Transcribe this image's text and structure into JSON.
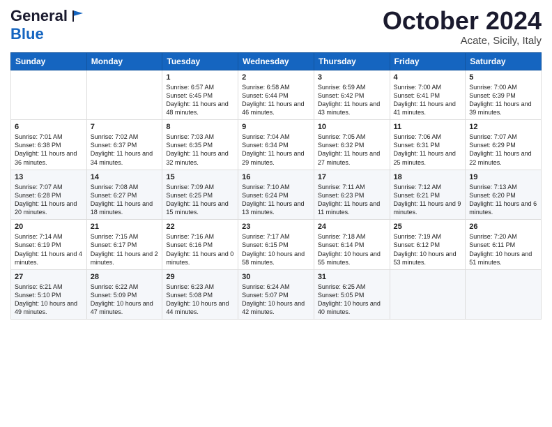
{
  "logo": {
    "general": "General",
    "blue": "Blue",
    "tagline": ""
  },
  "header": {
    "month": "October 2024",
    "location": "Acate, Sicily, Italy"
  },
  "weekdays": [
    "Sunday",
    "Monday",
    "Tuesday",
    "Wednesday",
    "Thursday",
    "Friday",
    "Saturday"
  ],
  "weeks": [
    [
      {
        "day": "",
        "info": ""
      },
      {
        "day": "",
        "info": ""
      },
      {
        "day": "1",
        "info": "Sunrise: 6:57 AM\nSunset: 6:45 PM\nDaylight: 11 hours and 48 minutes."
      },
      {
        "day": "2",
        "info": "Sunrise: 6:58 AM\nSunset: 6:44 PM\nDaylight: 11 hours and 46 minutes."
      },
      {
        "day": "3",
        "info": "Sunrise: 6:59 AM\nSunset: 6:42 PM\nDaylight: 11 hours and 43 minutes."
      },
      {
        "day": "4",
        "info": "Sunrise: 7:00 AM\nSunset: 6:41 PM\nDaylight: 11 hours and 41 minutes."
      },
      {
        "day": "5",
        "info": "Sunrise: 7:00 AM\nSunset: 6:39 PM\nDaylight: 11 hours and 39 minutes."
      }
    ],
    [
      {
        "day": "6",
        "info": "Sunrise: 7:01 AM\nSunset: 6:38 PM\nDaylight: 11 hours and 36 minutes."
      },
      {
        "day": "7",
        "info": "Sunrise: 7:02 AM\nSunset: 6:37 PM\nDaylight: 11 hours and 34 minutes."
      },
      {
        "day": "8",
        "info": "Sunrise: 7:03 AM\nSunset: 6:35 PM\nDaylight: 11 hours and 32 minutes."
      },
      {
        "day": "9",
        "info": "Sunrise: 7:04 AM\nSunset: 6:34 PM\nDaylight: 11 hours and 29 minutes."
      },
      {
        "day": "10",
        "info": "Sunrise: 7:05 AM\nSunset: 6:32 PM\nDaylight: 11 hours and 27 minutes."
      },
      {
        "day": "11",
        "info": "Sunrise: 7:06 AM\nSunset: 6:31 PM\nDaylight: 11 hours and 25 minutes."
      },
      {
        "day": "12",
        "info": "Sunrise: 7:07 AM\nSunset: 6:29 PM\nDaylight: 11 hours and 22 minutes."
      }
    ],
    [
      {
        "day": "13",
        "info": "Sunrise: 7:07 AM\nSunset: 6:28 PM\nDaylight: 11 hours and 20 minutes."
      },
      {
        "day": "14",
        "info": "Sunrise: 7:08 AM\nSunset: 6:27 PM\nDaylight: 11 hours and 18 minutes."
      },
      {
        "day": "15",
        "info": "Sunrise: 7:09 AM\nSunset: 6:25 PM\nDaylight: 11 hours and 15 minutes."
      },
      {
        "day": "16",
        "info": "Sunrise: 7:10 AM\nSunset: 6:24 PM\nDaylight: 11 hours and 13 minutes."
      },
      {
        "day": "17",
        "info": "Sunrise: 7:11 AM\nSunset: 6:23 PM\nDaylight: 11 hours and 11 minutes."
      },
      {
        "day": "18",
        "info": "Sunrise: 7:12 AM\nSunset: 6:21 PM\nDaylight: 11 hours and 9 minutes."
      },
      {
        "day": "19",
        "info": "Sunrise: 7:13 AM\nSunset: 6:20 PM\nDaylight: 11 hours and 6 minutes."
      }
    ],
    [
      {
        "day": "20",
        "info": "Sunrise: 7:14 AM\nSunset: 6:19 PM\nDaylight: 11 hours and 4 minutes."
      },
      {
        "day": "21",
        "info": "Sunrise: 7:15 AM\nSunset: 6:17 PM\nDaylight: 11 hours and 2 minutes."
      },
      {
        "day": "22",
        "info": "Sunrise: 7:16 AM\nSunset: 6:16 PM\nDaylight: 11 hours and 0 minutes."
      },
      {
        "day": "23",
        "info": "Sunrise: 7:17 AM\nSunset: 6:15 PM\nDaylight: 10 hours and 58 minutes."
      },
      {
        "day": "24",
        "info": "Sunrise: 7:18 AM\nSunset: 6:14 PM\nDaylight: 10 hours and 55 minutes."
      },
      {
        "day": "25",
        "info": "Sunrise: 7:19 AM\nSunset: 6:12 PM\nDaylight: 10 hours and 53 minutes."
      },
      {
        "day": "26",
        "info": "Sunrise: 7:20 AM\nSunset: 6:11 PM\nDaylight: 10 hours and 51 minutes."
      }
    ],
    [
      {
        "day": "27",
        "info": "Sunrise: 6:21 AM\nSunset: 5:10 PM\nDaylight: 10 hours and 49 minutes."
      },
      {
        "day": "28",
        "info": "Sunrise: 6:22 AM\nSunset: 5:09 PM\nDaylight: 10 hours and 47 minutes."
      },
      {
        "day": "29",
        "info": "Sunrise: 6:23 AM\nSunset: 5:08 PM\nDaylight: 10 hours and 44 minutes."
      },
      {
        "day": "30",
        "info": "Sunrise: 6:24 AM\nSunset: 5:07 PM\nDaylight: 10 hours and 42 minutes."
      },
      {
        "day": "31",
        "info": "Sunrise: 6:25 AM\nSunset: 5:05 PM\nDaylight: 10 hours and 40 minutes."
      },
      {
        "day": "",
        "info": ""
      },
      {
        "day": "",
        "info": ""
      }
    ]
  ]
}
